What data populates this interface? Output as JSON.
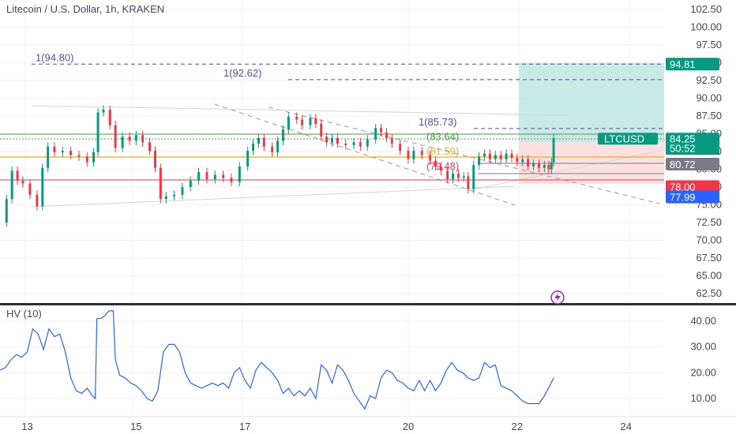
{
  "header": {
    "title": "Litecoin / U.S. Dollar, 1h, KRAKEN"
  },
  "chart_data": [
    {
      "type": "candlestick",
      "title": "Litecoin / U.S. Dollar, 1h, KRAKEN",
      "ylim": [
        61.5,
        103.6
      ],
      "yticks": [
        "102.50",
        "100.00",
        "97.50",
        "95.00",
        "92.50",
        "90.00",
        "87.50",
        "85.00",
        "82.50",
        "80.00",
        "77.50",
        "75.00",
        "72.50",
        "70.00",
        "67.50",
        "65.00",
        "62.50"
      ],
      "ytick_values": [
        102.5,
        100,
        97.5,
        95,
        92.5,
        90,
        87.5,
        85,
        82.5,
        80,
        77.5,
        75,
        72.5,
        70,
        67.5,
        65,
        62.5
      ],
      "xticks": [
        "13",
        "15",
        "17",
        "20",
        "22",
        "24"
      ],
      "xtick_positions": [
        0.5,
        2.5,
        4.5,
        7.5,
        9.5,
        11.5
      ],
      "xlim": [
        0,
        12.2
      ],
      "series": [
        {
          "name": "LTCUSD",
          "close_points": [
            [
              0.0,
              72.5
            ],
            [
              0.12,
              75.8
            ],
            [
              0.22,
              79.8
            ],
            [
              0.32,
              78.4
            ],
            [
              0.42,
              78.0
            ],
            [
              0.55,
              76.4
            ],
            [
              0.68,
              74.8
            ],
            [
              0.78,
              80.2
            ],
            [
              0.88,
              83.2
            ],
            [
              1.0,
              82.4
            ],
            [
              1.15,
              82.6
            ],
            [
              1.3,
              82.0
            ],
            [
              1.45,
              81.8
            ],
            [
              1.6,
              81.0
            ],
            [
              1.72,
              82.4
            ],
            [
              1.8,
              88.0
            ],
            [
              1.9,
              88.4
            ],
            [
              2.02,
              86.2
            ],
            [
              2.12,
              83.0
            ],
            [
              2.25,
              84.6
            ],
            [
              2.38,
              84.0
            ],
            [
              2.5,
              84.8
            ],
            [
              2.62,
              83.8
            ],
            [
              2.75,
              82.6
            ],
            [
              2.85,
              80.2
            ],
            [
              2.95,
              75.8
            ],
            [
              3.05,
              76.2
            ],
            [
              3.2,
              76.4
            ],
            [
              3.35,
              77.5
            ],
            [
              3.5,
              78.4
            ],
            [
              3.65,
              79.6
            ],
            [
              3.8,
              78.6
            ],
            [
              3.95,
              79.2
            ],
            [
              4.1,
              78.8
            ],
            [
              4.25,
              78.2
            ],
            [
              4.4,
              80.4
            ],
            [
              4.55,
              82.6
            ],
            [
              4.65,
              83.6
            ],
            [
              4.75,
              84.4
            ],
            [
              4.85,
              83.2
            ],
            [
              5.0,
              82.4
            ],
            [
              5.1,
              84.0
            ],
            [
              5.2,
              85.6
            ],
            [
              5.3,
              87.4
            ],
            [
              5.45,
              87.0
            ],
            [
              5.55,
              86.2
            ],
            [
              5.7,
              87.2
            ],
            [
              5.8,
              86.4
            ],
            [
              5.9,
              84.6
            ],
            [
              6.0,
              83.8
            ],
            [
              6.1,
              84.4
            ],
            [
              6.2,
              83.6
            ],
            [
              6.35,
              83.4
            ],
            [
              6.5,
              83.8
            ],
            [
              6.62,
              83.2
            ],
            [
              6.75,
              84.2
            ],
            [
              6.9,
              85.8
            ],
            [
              7.0,
              85.2
            ],
            [
              7.1,
              84.4
            ],
            [
              7.2,
              83.6
            ],
            [
              7.35,
              82.6
            ],
            [
              7.5,
              81.4
            ],
            [
              7.6,
              82.6
            ],
            [
              7.75,
              82.0
            ],
            [
              7.9,
              81.2
            ],
            [
              8.0,
              80.4
            ],
            [
              8.1,
              79.8
            ],
            [
              8.22,
              78.6
            ],
            [
              8.32,
              79.4
            ],
            [
              8.42,
              78.8
            ],
            [
              8.52,
              79.0
            ],
            [
              8.6,
              77.2
            ],
            [
              8.7,
              80.6
            ],
            [
              8.8,
              81.8
            ],
            [
              8.9,
              82.2
            ],
            [
              9.0,
              81.4
            ],
            [
              9.1,
              82.0
            ],
            [
              9.2,
              81.4
            ],
            [
              9.3,
              82.2
            ],
            [
              9.4,
              81.6
            ],
            [
              9.5,
              81.0
            ],
            [
              9.6,
              81.4
            ],
            [
              9.7,
              80.4
            ],
            [
              9.8,
              80.8
            ],
            [
              9.9,
              80.2
            ],
            [
              10.0,
              80.6
            ],
            [
              10.08,
              80.0
            ],
            [
              10.13,
              81.0
            ],
            [
              10.17,
              84.4
            ]
          ]
        }
      ],
      "price_lines": [
        {
          "label": "LTCUSD",
          "value": 84.25,
          "value_text": "84.25",
          "color": "#089981"
        },
        {
          "label": "countdown",
          "value_text": "50:52"
        },
        {
          "label": "level",
          "value": 80.72,
          "value_text": "80.72",
          "color": "#787b86"
        },
        {
          "label": "level",
          "value": 78.0,
          "value_text": "78.00",
          "color": "#f23645"
        },
        {
          "label": "level",
          "value": 77.99,
          "value_text": "77.99",
          "color": "#2962ff"
        },
        {
          "label": "target",
          "value": 94.81,
          "value_text": "94.81",
          "color": "#089981"
        }
      ],
      "fib_annotations": [
        {
          "text": "1(94.80)",
          "value": 94.8,
          "color": "#5b4a9b"
        },
        {
          "text": "1(92.62)",
          "value": 92.62,
          "color": "#5b4a9b"
        },
        {
          "text": "1(85.73)",
          "value": 85.73,
          "color": "#5b4a9b"
        },
        {
          "text": "(83.64)",
          "value": 83.64,
          "color": "#43a047"
        },
        {
          "text": "(81.59)",
          "value": 81.59,
          "color": "#f5a623"
        },
        {
          "text": "(79.48)",
          "value": 79.48,
          "color": "#f23645"
        }
      ],
      "colors": {
        "up": "#089981",
        "down": "#f23645",
        "profit_zone": "#b2dfdb",
        "loss_zone": "#fcd9d9"
      }
    },
    {
      "type": "line",
      "title": "HV (10)",
      "ylim": [
        4.5,
        46
      ],
      "yticks": [
        "40.00",
        "30.00",
        "20.00",
        "10.00"
      ],
      "ytick_values": [
        40,
        30,
        20,
        10
      ],
      "series": [
        {
          "name": "HV (10)",
          "color": "#2962ff",
          "points": [
            [
              0.0,
              21
            ],
            [
              0.1,
              22
            ],
            [
              0.2,
              25
            ],
            [
              0.3,
              27
            ],
            [
              0.4,
              26
            ],
            [
              0.5,
              28
            ],
            [
              0.6,
              37
            ],
            [
              0.7,
              35
            ],
            [
              0.8,
              29
            ],
            [
              0.9,
              37
            ],
            [
              1.0,
              34
            ],
            [
              1.1,
              35
            ],
            [
              1.2,
              28
            ],
            [
              1.3,
              18
            ],
            [
              1.4,
              13
            ],
            [
              1.5,
              12
            ],
            [
              1.6,
              14
            ],
            [
              1.7,
              11
            ],
            [
              1.75,
              10
            ],
            [
              1.78,
              41
            ],
            [
              1.85,
              41
            ],
            [
              1.92,
              42
            ],
            [
              2.0,
              44
            ],
            [
              2.08,
              44
            ],
            [
              2.12,
              25
            ],
            [
              2.2,
              19
            ],
            [
              2.3,
              18
            ],
            [
              2.4,
              16
            ],
            [
              2.5,
              15
            ],
            [
              2.6,
              13
            ],
            [
              2.7,
              10
            ],
            [
              2.8,
              9
            ],
            [
              2.9,
              13
            ],
            [
              3.0,
              28
            ],
            [
              3.1,
              31
            ],
            [
              3.2,
              31
            ],
            [
              3.3,
              28
            ],
            [
              3.4,
              20
            ],
            [
              3.5,
              16
            ],
            [
              3.6,
              15
            ],
            [
              3.7,
              14
            ],
            [
              3.8,
              15
            ],
            [
              3.9,
              16
            ],
            [
              4.0,
              15
            ],
            [
              4.1,
              16
            ],
            [
              4.2,
              14
            ],
            [
              4.3,
              20
            ],
            [
              4.4,
              22
            ],
            [
              4.5,
              17
            ],
            [
              4.6,
              14
            ],
            [
              4.7,
              21
            ],
            [
              4.8,
              24
            ],
            [
              4.9,
              22
            ],
            [
              5.0,
              20
            ],
            [
              5.1,
              17
            ],
            [
              5.2,
              12
            ],
            [
              5.3,
              14
            ],
            [
              5.4,
              11
            ],
            [
              5.5,
              13
            ],
            [
              5.6,
              11
            ],
            [
              5.7,
              14
            ],
            [
              5.8,
              10
            ],
            [
              5.9,
              23
            ],
            [
              6.0,
              21
            ],
            [
              6.1,
              16
            ],
            [
              6.2,
              23
            ],
            [
              6.3,
              21
            ],
            [
              6.4,
              17
            ],
            [
              6.5,
              12
            ],
            [
              6.6,
              9
            ],
            [
              6.7,
              6
            ],
            [
              6.8,
              11
            ],
            [
              6.9,
              10
            ],
            [
              7.0,
              18
            ],
            [
              7.1,
              21
            ],
            [
              7.2,
              20
            ],
            [
              7.3,
              17
            ],
            [
              7.4,
              16
            ],
            [
              7.5,
              14
            ],
            [
              7.6,
              13
            ],
            [
              7.7,
              17
            ],
            [
              7.8,
              13
            ],
            [
              7.9,
              17
            ],
            [
              8.0,
              13
            ],
            [
              8.1,
              16
            ],
            [
              8.2,
              21
            ],
            [
              8.3,
              24
            ],
            [
              8.4,
              21
            ],
            [
              8.5,
              20
            ],
            [
              8.6,
              18
            ],
            [
              8.7,
              17
            ],
            [
              8.8,
              18
            ],
            [
              8.9,
              24
            ],
            [
              9.0,
              22
            ],
            [
              9.1,
              23
            ],
            [
              9.2,
              15
            ],
            [
              9.3,
              14
            ],
            [
              9.4,
              13
            ],
            [
              9.5,
              11
            ],
            [
              9.6,
              9
            ],
            [
              9.7,
              8
            ],
            [
              9.8,
              8
            ],
            [
              9.9,
              8
            ],
            [
              10.0,
              11
            ],
            [
              10.1,
              15
            ],
            [
              10.17,
              18
            ]
          ]
        }
      ]
    }
  ]
}
